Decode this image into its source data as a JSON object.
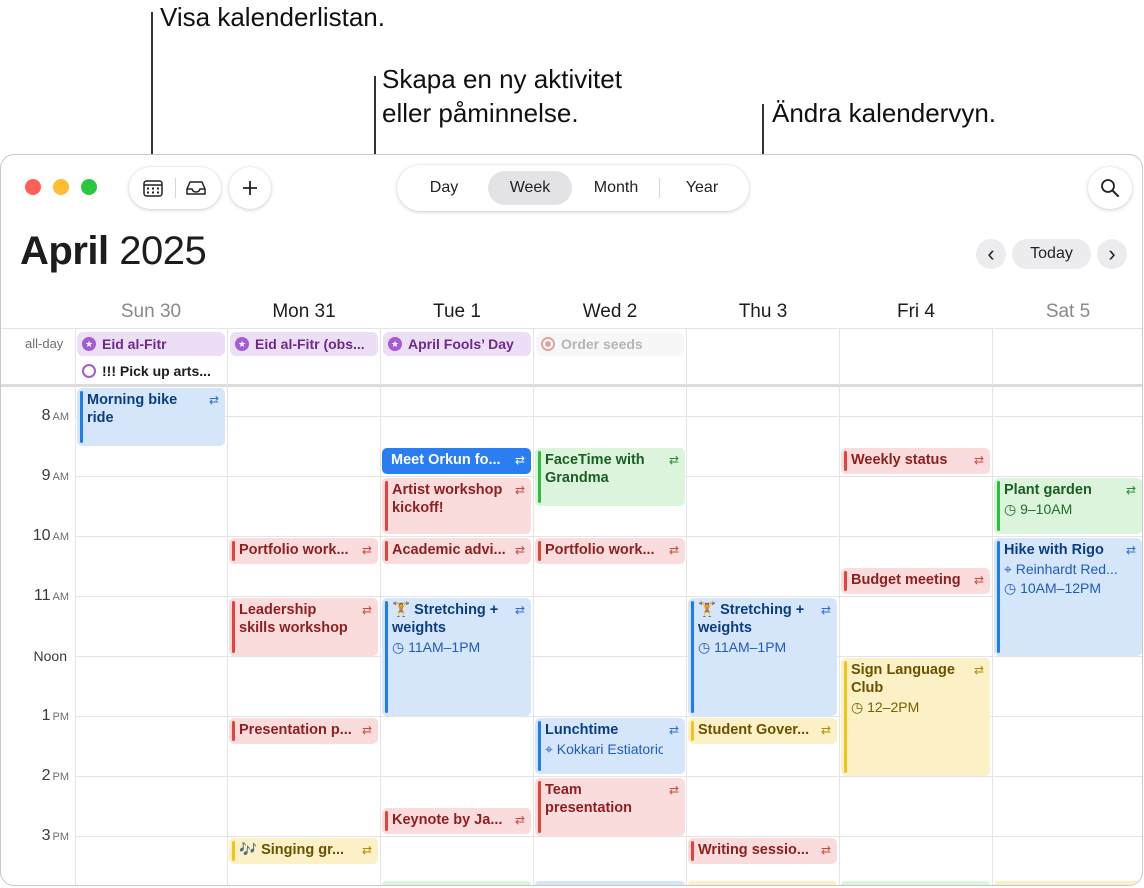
{
  "callouts": {
    "calendar_list": "Visa kalenderlistan.",
    "new_event_line1": "Skapa en ny aktivitet",
    "new_event_line2": "eller påminnelse.",
    "change_view": "Ändra kalendervyn."
  },
  "toolbar": {
    "calendar_list_icon": "calendar-grid-icon",
    "inbox_icon": "inbox-tray-icon",
    "add_label": "+",
    "views": [
      "Day",
      "Week",
      "Month",
      "Year"
    ],
    "selected_view": "Week",
    "search_icon": "magnifier-icon"
  },
  "header": {
    "month": "April",
    "year": "2025",
    "prev": "‹",
    "today": "Today",
    "next": "›"
  },
  "days": [
    "Sun 30",
    "Mon 31",
    "Tue 1",
    "Wed 2",
    "Thu 3",
    "Fri 4",
    "Sat 5"
  ],
  "all_day_label": "all-day",
  "all_day_events": {
    "sun_eid": "Eid al-Fitr",
    "sun_reminder": "!!! Pick up arts...",
    "mon_eid": "Eid al-Fitr (obs...",
    "tue_fools": "April Fools’ Day",
    "wed_seeds": "Order seeds"
  },
  "hours": [
    {
      "h": "8",
      "ap": "AM"
    },
    {
      "h": "9",
      "ap": "AM"
    },
    {
      "h": "10",
      "ap": "AM"
    },
    {
      "h": "11",
      "ap": "AM"
    },
    {
      "h": "Noon",
      "ap": ""
    },
    {
      "h": "1",
      "ap": "PM"
    },
    {
      "h": "2",
      "ap": "PM"
    },
    {
      "h": "3",
      "ap": "PM"
    }
  ],
  "events": {
    "bike": "Morning bike ride",
    "orkun": "Meet Orkun fo...",
    "artist": "Artist workshop kickoff!",
    "facetime": "FaceTime with Grandma",
    "weekly": "Weekly status",
    "plant": "Plant garden",
    "plant_time": "9–10AM",
    "portfolio_mon": "Portfolio work...",
    "academic": "Academic advi...",
    "portfolio_wed": "Portfolio work...",
    "hike": "Hike with Rigo",
    "hike_loc": "Reinhardt Red...",
    "hike_time": "10AM–12PM",
    "budget": "Budget meeting",
    "leadership": "Leadership skills workshop",
    "stretch_tue": "🏋 Stretching + weights",
    "stretch_tue_time": "11AM–1PM",
    "stretch_thu": "🏋 Stretching + weights",
    "stretch_thu_time": "11AM–1PM",
    "sign": "Sign Language Club",
    "sign_time": "12–2PM",
    "presentation": "Presentation p...",
    "lunch": "Lunchtime",
    "lunch_loc": "Kokkari Estiatorio",
    "student": "Student Gover...",
    "team": "Team presentation",
    "keynote": "Keynote by Ja...",
    "singing": "🎶 Singing gr...",
    "writing": "Writing sessio..."
  },
  "repeat_glyph": "⇄",
  "clock_glyph": "◷",
  "location_glyph": "⌖"
}
